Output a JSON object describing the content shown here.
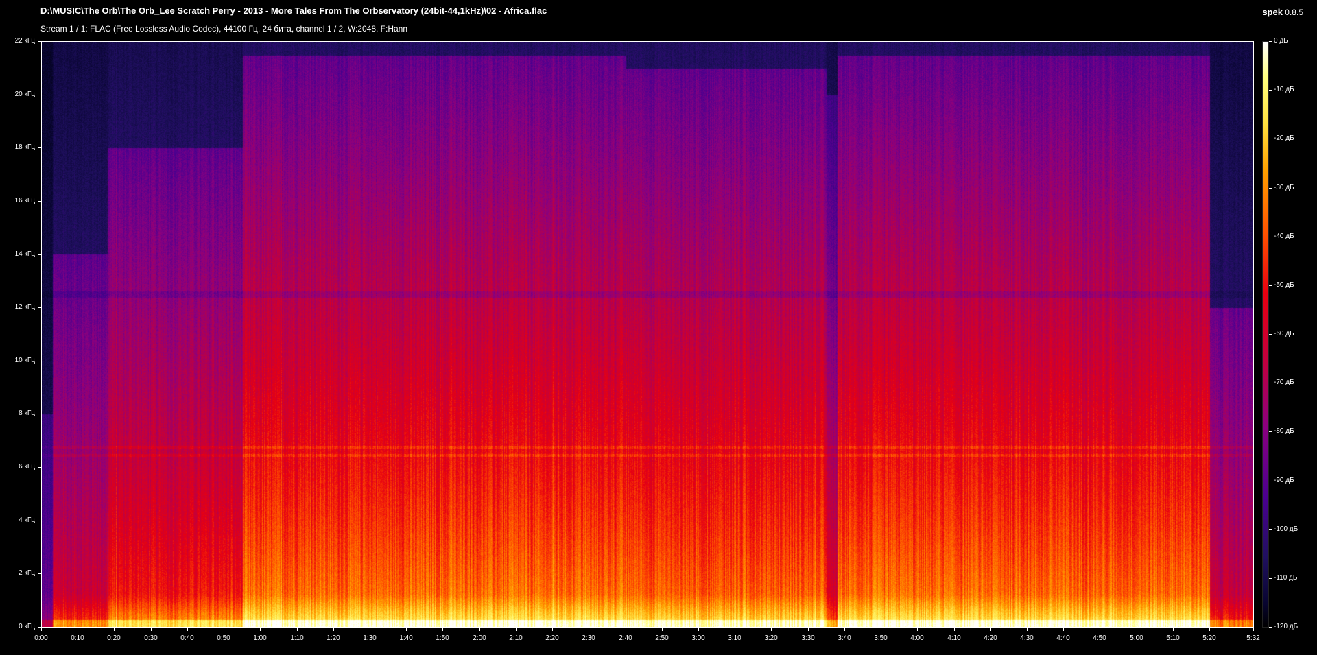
{
  "header": {
    "title": "D:\\MUSIC\\The Orb\\The Orb_Lee Scratch Perry - 2013 - More Tales From The Orbservatory (24bit-44,1kHz)\\02 - Africa.flac",
    "stream_info": "Stream 1 / 1: FLAC (Free Lossless Audio Codec), 44100 Гц, 24 бита, channel 1 / 2, W:2048, F:Hann",
    "app_name": "spek",
    "app_version": "0.8.5"
  },
  "chart_data": {
    "type": "heatmap",
    "x_label": "",
    "y_label": "",
    "xlim": [
      0,
      332
    ],
    "ylim": [
      0,
      22
    ],
    "color_range_db": [
      -120,
      0
    ],
    "y_ticks": [
      {
        "value": 0,
        "label": "0 кГц"
      },
      {
        "value": 2,
        "label": "2 кГц"
      },
      {
        "value": 4,
        "label": "4 кГц"
      },
      {
        "value": 6,
        "label": "6 кГц"
      },
      {
        "value": 8,
        "label": "8 кГц"
      },
      {
        "value": 10,
        "label": "10 кГц"
      },
      {
        "value": 12,
        "label": "12 кГц"
      },
      {
        "value": 14,
        "label": "14 кГц"
      },
      {
        "value": 16,
        "label": "16 кГц"
      },
      {
        "value": 18,
        "label": "18 кГц"
      },
      {
        "value": 20,
        "label": "20 кГц"
      },
      {
        "value": 22,
        "label": "22 кГц"
      }
    ],
    "x_ticks": [
      {
        "value": 0,
        "label": "0:00"
      },
      {
        "value": 10,
        "label": "0:10"
      },
      {
        "value": 20,
        "label": "0:20"
      },
      {
        "value": 30,
        "label": "0:30"
      },
      {
        "value": 40,
        "label": "0:40"
      },
      {
        "value": 50,
        "label": "0:50"
      },
      {
        "value": 60,
        "label": "1:00"
      },
      {
        "value": 70,
        "label": "1:10"
      },
      {
        "value": 80,
        "label": "1:20"
      },
      {
        "value": 90,
        "label": "1:30"
      },
      {
        "value": 100,
        "label": "1:40"
      },
      {
        "value": 110,
        "label": "1:50"
      },
      {
        "value": 120,
        "label": "2:00"
      },
      {
        "value": 130,
        "label": "2:10"
      },
      {
        "value": 140,
        "label": "2:20"
      },
      {
        "value": 150,
        "label": "2:30"
      },
      {
        "value": 160,
        "label": "2:40"
      },
      {
        "value": 170,
        "label": "2:50"
      },
      {
        "value": 180,
        "label": "3:00"
      },
      {
        "value": 190,
        "label": "3:10"
      },
      {
        "value": 200,
        "label": "3:20"
      },
      {
        "value": 210,
        "label": "3:30"
      },
      {
        "value": 220,
        "label": "3:40"
      },
      {
        "value": 230,
        "label": "3:50"
      },
      {
        "value": 240,
        "label": "4:00"
      },
      {
        "value": 250,
        "label": "4:10"
      },
      {
        "value": 260,
        "label": "4:20"
      },
      {
        "value": 270,
        "label": "4:30"
      },
      {
        "value": 280,
        "label": "4:40"
      },
      {
        "value": 290,
        "label": "4:50"
      },
      {
        "value": 300,
        "label": "5:00"
      },
      {
        "value": 310,
        "label": "5:10"
      },
      {
        "value": 320,
        "label": "5:20"
      },
      {
        "value": 332,
        "label": "5:32"
      }
    ],
    "legend_ticks": [
      {
        "value": 0,
        "label": "0 дБ"
      },
      {
        "value": -10,
        "label": "-10 дБ"
      },
      {
        "value": -20,
        "label": "-20 дБ"
      },
      {
        "value": -30,
        "label": "-30 дБ"
      },
      {
        "value": -40,
        "label": "-40 дБ"
      },
      {
        "value": -50,
        "label": "-50 дБ"
      },
      {
        "value": -60,
        "label": "-60 дБ"
      },
      {
        "value": -70,
        "label": "-70 дБ"
      },
      {
        "value": -80,
        "label": "-80 дБ"
      },
      {
        "value": -90,
        "label": "-90 дБ"
      },
      {
        "value": -100,
        "label": "-100 дБ"
      },
      {
        "value": -110,
        "label": "-110 дБ"
      },
      {
        "value": -120,
        "label": "-120 дБ"
      }
    ],
    "colormap": [
      "#000000",
      "#080530",
      "#201060",
      "#4a0090",
      "#8a0080",
      "#c00040",
      "#e80010",
      "#ff5000",
      "#ffa000",
      "#ffe040",
      "#ffff80",
      "#ffffff"
    ]
  }
}
